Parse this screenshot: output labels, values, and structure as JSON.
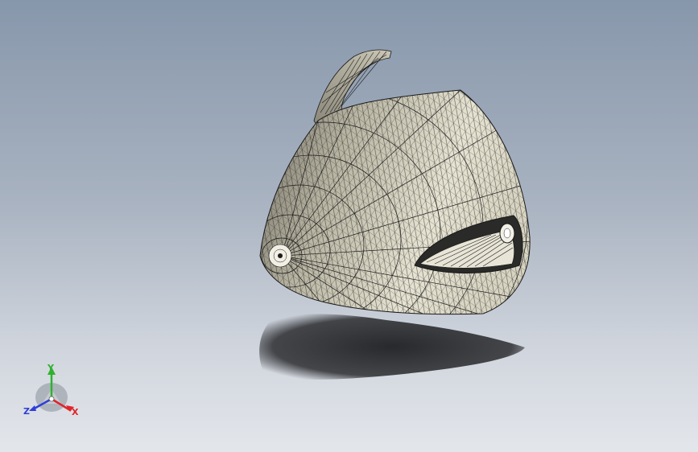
{
  "viewport": {
    "background_top": "#8797ab",
    "background_bottom": "#e3e6eb"
  },
  "model": {
    "surface_color": "#c9c6b5",
    "mesh_line_color": "#1a1a1a",
    "shadow_color": "#2b2c2f"
  },
  "triad": {
    "axes": [
      {
        "name": "y",
        "label": "Y",
        "color": "#2fb12f"
      },
      {
        "name": "x",
        "label": "X",
        "color": "#e0242a"
      },
      {
        "name": "z",
        "label": "Z",
        "color": "#2f3fd6"
      }
    ]
  }
}
